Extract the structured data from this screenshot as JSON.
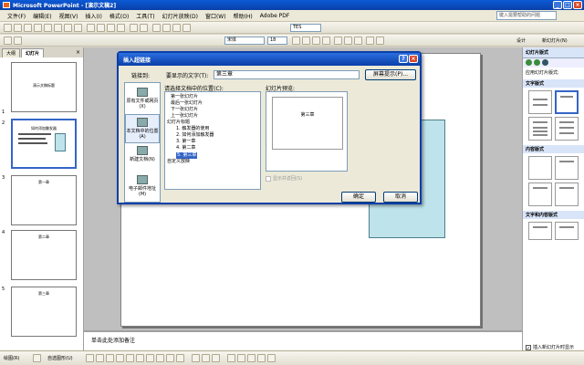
{
  "window": {
    "title": "Microsoft PowerPoint - [演示文稿2]"
  },
  "menu": {
    "items": [
      "文件(F)",
      "编辑(E)",
      "视图(V)",
      "插入(I)",
      "格式(O)",
      "工具(T)",
      "幻灯片放映(D)",
      "窗口(W)",
      "帮助(H)",
      "Adobe PDF"
    ],
    "help_placeholder": "键入需要帮助的问题"
  },
  "toolbar": {
    "font": "宋体",
    "size": "18",
    "tes": "TES",
    "design_label": "设计",
    "new_slide_label": "新幻灯片(N)"
  },
  "left_pane": {
    "tabs": [
      "大纲",
      "幻灯片"
    ],
    "close": "×",
    "slides": [
      {
        "num": "1",
        "text": "演示文稿标题"
      },
      {
        "num": "2",
        "text": "如何添加触发器"
      },
      {
        "num": "3",
        "text": "第一章"
      },
      {
        "num": "4",
        "text": "第二章"
      },
      {
        "num": "5",
        "text": "第三章"
      }
    ]
  },
  "notes": {
    "placeholder": "单击此处添加备注"
  },
  "task_pane": {
    "title": "幻灯片版式",
    "apply_label": "应用幻灯片版式:",
    "sections": [
      "文字版式",
      "内容版式",
      "文字和内容版式"
    ],
    "checkbox_label": "插入新幻灯片时显示"
  },
  "draw_toolbar": {
    "draw_label": "绘图(R)",
    "autoshapes_label": "自选图形(U)"
  },
  "dialog": {
    "title": "插入超链接",
    "link_to_label": "链接到:",
    "display_text_label": "要显示的文字(T):",
    "display_text_value": "第三章",
    "screentip_button": "屏幕提示(P)...",
    "select_place_label": "请选择文档中的位置(C):",
    "preview_label": "幻灯片预览:",
    "preview_slide_text": "第三章",
    "link_items": [
      "原有文件或网页(X)",
      "本文档中的位置(A)",
      "新建文档(N)",
      "电子邮件地址(M)"
    ],
    "tree": [
      "第一张幻灯片",
      "最后一张幻灯片",
      "下一张幻灯片",
      "上一张幻灯片",
      "幻灯片标题",
      "1. 触发器的使用",
      "2. 如何添加触发器",
      "3. 第一章",
      "4. 第二章",
      "5. 第三章",
      "自定义放映"
    ],
    "show_and_return": "显示并返回(S)",
    "ok": "确定",
    "cancel": "取消"
  }
}
